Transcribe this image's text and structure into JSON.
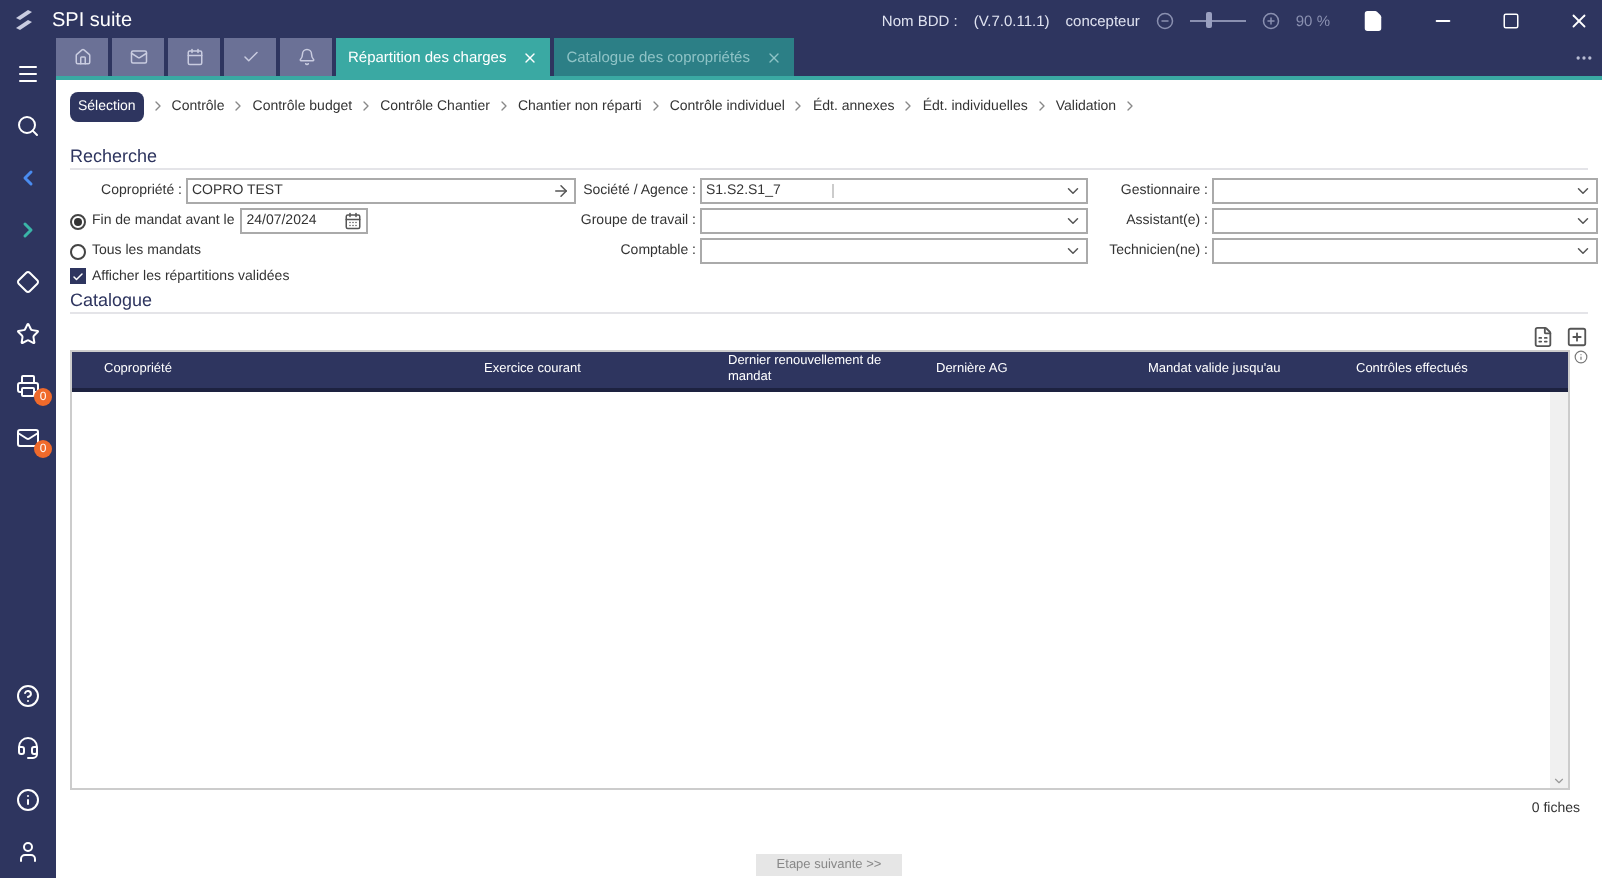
{
  "window": {
    "title": "SPI suite",
    "db_label": "Nom BDD :",
    "version": "(V.7.0.11.1)",
    "user": "concepteur",
    "zoom": {
      "level": 0.35,
      "reading": "90 %"
    }
  },
  "sidebar": {
    "badges": [
      "0",
      "0"
    ]
  },
  "tabs": [
    {
      "kind": "icon",
      "selected": false
    },
    {
      "kind": "icon",
      "selected": false
    },
    {
      "kind": "icon",
      "selected": false
    },
    {
      "kind": "icon",
      "selected": false
    },
    {
      "kind": "icon",
      "selected": false
    },
    {
      "kind": "text",
      "label": "Répartition des charges",
      "selected": true
    },
    {
      "kind": "text",
      "label": "Catalogue des copropriétés",
      "selected": false
    }
  ],
  "steps": [
    {
      "label": "Sélection",
      "selected": true
    },
    {
      "label": "Contrôle",
      "selected": false
    },
    {
      "label": "Contrôle budget",
      "selected": false
    },
    {
      "label": "Contrôle Chantier",
      "selected": false
    },
    {
      "label": "Chantier non réparti",
      "selected": false
    },
    {
      "label": "Contrôle individuel",
      "selected": false
    },
    {
      "label": "Édt. annexes",
      "selected": false
    },
    {
      "label": "Édt. individuelles",
      "selected": false
    },
    {
      "label": "Validation",
      "selected": false
    }
  ],
  "search": {
    "title": "Recherche",
    "copropriete": {
      "label": "Copropriété :",
      "value": "COPRO TEST"
    },
    "societe": {
      "label": "Société / Agence :",
      "value": "S1.S2.S1_7"
    },
    "groupe": {
      "label": "Groupe de travail :"
    },
    "comptable": {
      "label": "Comptable :"
    },
    "gestionnaire": {
      "label": "Gestionnaire :"
    },
    "assistant": {
      "label": "Assistant(e) :"
    },
    "technicien": {
      "label": "Technicien(ne) :"
    },
    "mandate_options": [
      {
        "label": "Fin de mandat avant le",
        "selected": true,
        "date": "24/07/2024"
      },
      {
        "label": "Tous les mandats",
        "selected": false
      }
    ],
    "show_validated": {
      "label": "Afficher les répartitions validées",
      "checked": true
    }
  },
  "catalogue": {
    "title": "Catalogue",
    "columns": [
      "Copropriété",
      "Exercice courant",
      "Dernier renouvellement de mandat",
      "Dernière AG",
      "Mandat valide jusqu'au",
      "Contrôles effectués"
    ],
    "count": "0 fiches"
  },
  "next_button": {
    "label": "Etape suivante >>",
    "disabled": true
  }
}
